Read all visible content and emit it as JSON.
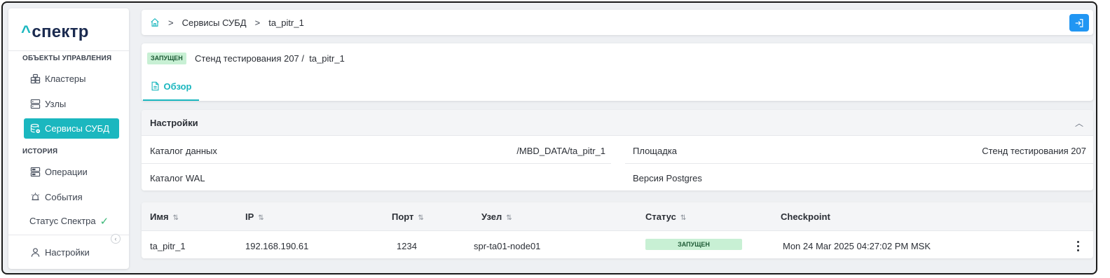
{
  "sidebar": {
    "logo": "спектр",
    "sections": [
      {
        "label": "ОБЪЕКТЫ УПРАВЛЕНИЯ"
      },
      {
        "label": "ИСТОРИЯ"
      }
    ],
    "items": [
      {
        "label": "Кластеры",
        "icon": "cluster-icon"
      },
      {
        "label": "Узлы",
        "icon": "server-icon"
      },
      {
        "label": "Сервисы СУБД",
        "icon": "database-service-icon",
        "active": true
      },
      {
        "label": "Операции",
        "icon": "operations-icon"
      },
      {
        "label": "События",
        "icon": "events-icon"
      },
      {
        "label": "Статус Спектра",
        "icon": "check-icon"
      },
      {
        "label": "Настройки",
        "icon": "user-icon"
      }
    ]
  },
  "breadcrumb": {
    "items": [
      "Сервисы СУБД",
      "ta_pitr_1"
    ]
  },
  "header": {
    "status": "ЗАПУЩЕН",
    "title": "Стенд тестирования 207 /  ta_pitr_1",
    "tab": "Обзор"
  },
  "settings": {
    "title": "Настройки",
    "props": [
      {
        "label": "Каталог данных",
        "value": "/MBD_DATA/ta_pitr_1"
      },
      {
        "label": "Площадка",
        "value": "Стенд тестирования 207"
      },
      {
        "label": "Каталог WAL",
        "value": ""
      },
      {
        "label": "Версия Postgres",
        "value": ""
      }
    ]
  },
  "table": {
    "columns": [
      "Имя",
      "IP",
      "Порт",
      "Узел",
      "Статус",
      "Checkpoint"
    ],
    "rows": [
      {
        "name": "ta_pitr_1",
        "ip": "192.168.190.61",
        "port": "1234",
        "node": "spr-ta01-node01",
        "status": "ЗАПУЩЕН",
        "checkpoint": "Mon 24 Mar 2025 04:27:02 PM MSK"
      }
    ]
  },
  "colors": {
    "accent": "#1bb7bf",
    "primary_button": "#2196f3",
    "status_bg": "#c8f0d4",
    "status_text": "#1d5a35"
  }
}
